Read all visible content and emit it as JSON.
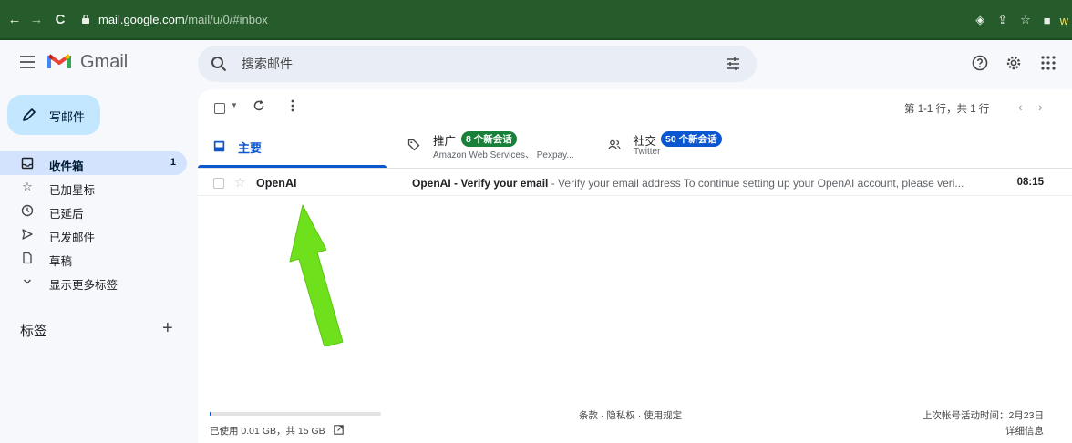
{
  "browser": {
    "url_host": "mail.google.com",
    "url_path": "/mail/u/0/#inbox",
    "profile_initial": "w"
  },
  "header": {
    "app_name": "Gmail",
    "search_placeholder": "搜索邮件"
  },
  "sidebar": {
    "compose_label": "写邮件",
    "items": [
      {
        "label": "收件箱",
        "icon": "inbox-icon",
        "count": "1",
        "active": true
      },
      {
        "label": "已加星标",
        "icon": "star-icon",
        "count": "",
        "active": false
      },
      {
        "label": "已延后",
        "icon": "clock-icon",
        "count": "",
        "active": false
      },
      {
        "label": "已发邮件",
        "icon": "send-icon",
        "count": "",
        "active": false
      },
      {
        "label": "草稿",
        "icon": "draft-icon",
        "count": "",
        "active": false
      },
      {
        "label": "显示更多标签",
        "icon": "chevron-down-icon",
        "count": "",
        "active": false
      }
    ],
    "labels_title": "标签"
  },
  "toolbar": {
    "pager_text": "第 1-1 行，共 1 行"
  },
  "tabs": {
    "primary": {
      "label": "主要"
    },
    "promotions": {
      "label": "推广",
      "badge": "8 个新会话",
      "sub": "Amazon Web Services、 Pexpay..."
    },
    "social": {
      "label": "社交",
      "badge": "50 个新会话",
      "sub": "Twitter"
    }
  },
  "emails": [
    {
      "sender": "OpenAI",
      "subject": "OpenAI - Verify your email",
      "snippet": " - Verify your email address To continue setting up your OpenAI account, please veri...",
      "time": "08:15",
      "starred": false,
      "unread": true
    }
  ],
  "footer": {
    "storage_text": "已使用 0.01 GB，共 15 GB",
    "storage_used_fraction": 0.001,
    "links": "条款 · 隐私权 · 使用规定",
    "last_activity": "上次帐号活动时间：2月23日",
    "details": "详细信息"
  },
  "colors": {
    "browser_bar": "#265c2c",
    "compose_bg": "#c2e7ff",
    "active_item_bg": "#d3e3fd",
    "primary_blue": "#0b57d0",
    "promo_badge": "#188038",
    "arrow_green": "#6fe01c"
  }
}
